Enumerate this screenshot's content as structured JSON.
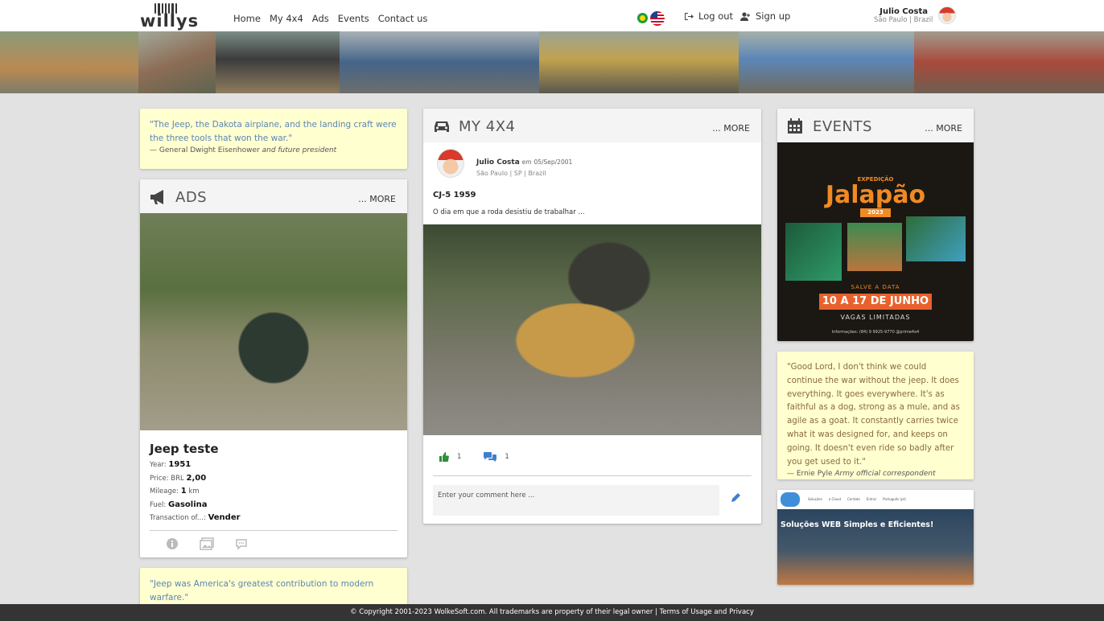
{
  "header": {
    "logo_text": "willys",
    "nav": [
      "Home",
      "My 4x4",
      "Ads",
      "Events",
      "Contact us"
    ],
    "logout_label": "Log out",
    "signup_label": "Sign up",
    "user_name": "Julio Costa",
    "user_location": "São Paulo | Brazil"
  },
  "quotes": {
    "q1_text": "\"The Jeep, the Dakota airplane, and the landing craft were the three tools that won the war.\"",
    "q1_author": "— General Dwight Eisenhower",
    "q1_role": "and future president",
    "q2_text": "\"Good Lord, I don't think we could continue the war without the jeep. It does everything. It goes everywhere. It's as faithful as a dog, strong as a mule, and as agile as a goat. It constantly carries twice what it was designed for, and keeps on going. It doesn't even ride so badly after you get used to it.\"",
    "q2_author": "— Ernie Pyle",
    "q2_role": "Army official correspondent",
    "q3_text": "\"Jeep was America's greatest contribution to modern warfare.\""
  },
  "ads": {
    "title": "ADS",
    "more": "... MORE",
    "item_title": "Jeep teste",
    "year_label": "Year:",
    "year": "1951",
    "price_label": "Price: BRL",
    "price": "2,00",
    "mileage_label": "Mileage:",
    "mileage": "1",
    "mileage_unit": "km",
    "fuel_label": "Fuel:",
    "fuel": "Gasolina",
    "transaction_label": "Transaction of...:",
    "transaction": "Vender"
  },
  "my4x4": {
    "title": "MY 4X4",
    "more": "... MORE",
    "author": "Julio Costa",
    "date_prefix": "em",
    "date": "05/Sep/2001",
    "location": "São Paulo | SP | Brazil",
    "post_title": "CJ-5 1959",
    "post_text": "O dia em que a roda desistiu de trabalhar ...",
    "likes": "1",
    "comments": "1",
    "comment_placeholder": "Enter your comment here ..."
  },
  "events": {
    "title": "EVENTS",
    "more": "... MORE",
    "poster_tag": "EXPEDIÇÃO",
    "poster_title": "Jalapão",
    "poster_year": "2023",
    "poster_save": "SALVE A DATA",
    "poster_dates": "10 A 17 DE JUNHO",
    "poster_spots": "VAGAS LIMITADAS",
    "poster_info": "Informações:  (84) 9 9925-9770  @prime4x4"
  },
  "ad_banner": {
    "headline": "Soluções WEB Simples e Eficientes!",
    "menu": [
      "Soluções",
      "a Cloud",
      "Contato",
      "Entrar",
      "Português (pt)"
    ]
  },
  "footer": {
    "copyright": "© Copyright 2001-2023 WolkeSoft.com. All trademarks are property of their legal owner",
    "terms": "Terms of Usage and Privacy"
  },
  "colors": {
    "quote_bg": "#ffffd0",
    "quote_text": "#5b85b5",
    "like_green": "#2f8f3a",
    "comment_blue": "#3f7fd0"
  }
}
